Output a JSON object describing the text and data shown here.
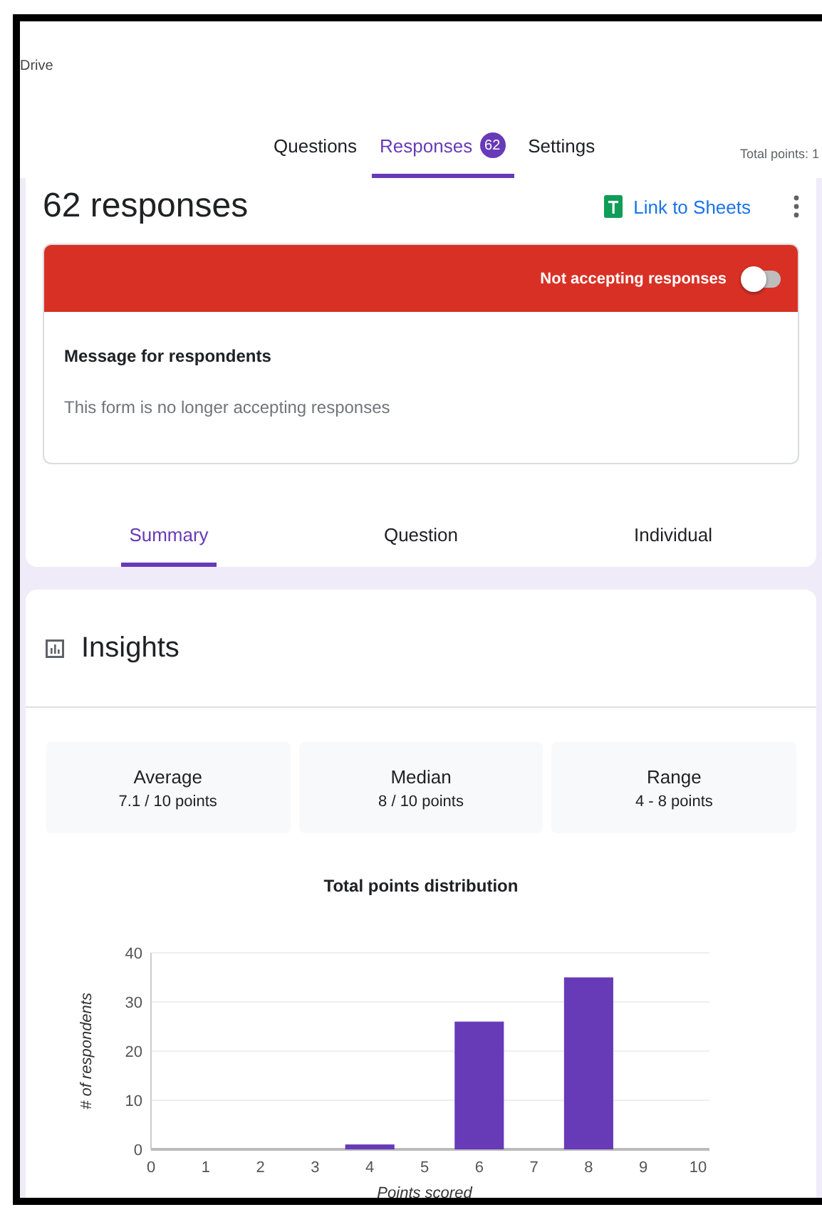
{
  "header": {
    "app_name": "Drive",
    "total_points": "Total points: 1"
  },
  "tabs": [
    {
      "label": "Questions",
      "selected": false
    },
    {
      "label": "Responses",
      "selected": true,
      "badge": "62"
    },
    {
      "label": "Settings",
      "selected": false
    }
  ],
  "responses": {
    "title": "62 responses",
    "link_label": "Link to Sheets",
    "status_label": "Not accepting responses",
    "accepting": false,
    "message_heading": "Message for respondents",
    "message": "This form is no longer accepting responses"
  },
  "view_tabs": [
    {
      "label": "Summary",
      "selected": true
    },
    {
      "label": "Question",
      "selected": false
    },
    {
      "label": "Individual",
      "selected": false
    }
  ],
  "insights": {
    "title": "Insights",
    "stats": [
      {
        "label": "Average",
        "value": "7.1 / 10 points"
      },
      {
        "label": "Median",
        "value": "8 / 10 points"
      },
      {
        "label": "Range",
        "value": "4 - 8 points"
      }
    ],
    "chart_data": {
      "type": "bar",
      "title": "Total points distribution",
      "xlabel": "Points scored",
      "ylabel": "# of respondents",
      "categories": [
        "0",
        "1",
        "2",
        "3",
        "4",
        "5",
        "6",
        "7",
        "8",
        "9",
        "10"
      ],
      "grid": true,
      "series": [
        {
          "color": "#673ab7",
          "values": [
            0,
            0,
            0,
            0,
            1,
            0,
            26,
            0,
            35,
            0,
            0
          ]
        }
      ],
      "ylim": [
        0,
        40
      ],
      "yticks": [
        0,
        10,
        20,
        30,
        40
      ]
    }
  }
}
